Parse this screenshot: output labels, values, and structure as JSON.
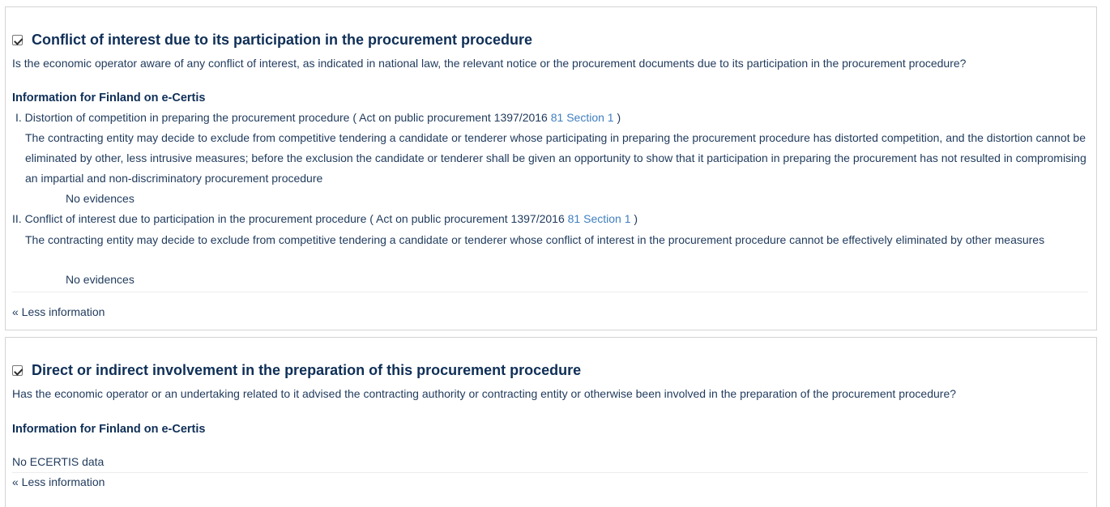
{
  "sections": [
    {
      "title": "Conflict of interest due to its participation in the procurement procedure",
      "question": "Is the economic operator aware of any conflict of interest, as indicated in national law, the relevant notice or the procurement documents due to its participation in the procurement procedure?",
      "ecertis_heading": "Information for Finland on e-Certis",
      "items": [
        {
          "numeral": "I.",
          "name": "Distortion of competition in preparing the procurement procedure",
          "ref_prefix": "( Act on public procurement 1397/2016",
          "ref_link": "81 Section 1",
          "ref_suffix": ")",
          "description": "The contracting entity may decide to exclude from competitive tendering a candidate or tenderer whose participating in preparing the procurement procedure has distorted competition, and the distortion cannot be eliminated by other, less intrusive measures; before the exclusion the candidate or tenderer shall be given an opportunity to show that it participation in preparing the procurement has not resulted in compromising an impartial and non-discriminatory procurement procedure",
          "evidence": "No evidences"
        },
        {
          "numeral": "II.",
          "name": "Conflict of interest due to participation in the procurement procedure",
          "ref_prefix": "( Act on public procurement 1397/2016",
          "ref_link": "81 Section 1",
          "ref_suffix": ")",
          "description": "The contracting entity may decide to exclude from competitive tendering a candidate or tenderer whose conflict of interest in the procurement procedure cannot be effectively eliminated by other measures",
          "evidence": "No evidences"
        }
      ],
      "less_info": "« Less information"
    },
    {
      "title": "Direct or indirect involvement in the preparation of this procurement procedure",
      "question": "Has the economic operator or an undertaking related to it advised the contracting authority or contracting entity or otherwise been involved in the preparation of the procurement procedure?",
      "ecertis_heading": "Information for Finland on e-Certis",
      "no_data": "No ECERTIS data",
      "less_info": "« Less information"
    }
  ],
  "colors": {
    "title": "#0f2f57",
    "text": "#1f3a5c",
    "link": "#3f7fbf",
    "border": "#d4d4d4"
  }
}
